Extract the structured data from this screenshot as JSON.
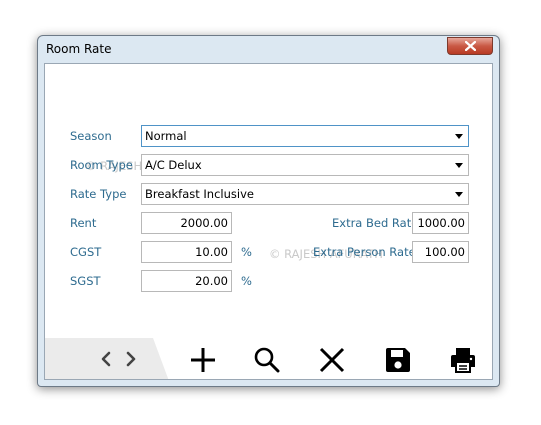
{
  "window": {
    "title": "Room Rate"
  },
  "form": {
    "season": {
      "label": "Season",
      "value": "Normal"
    },
    "room_type": {
      "label": "Room Type",
      "value": "A/C Delux"
    },
    "rate_type": {
      "label": "Rate Type",
      "value": "Breakfast Inclusive"
    },
    "rent": {
      "label": "Rent",
      "value": "2000.00"
    },
    "cgst": {
      "label": "CGST",
      "value": "10.00",
      "unit": "%"
    },
    "sgst": {
      "label": "SGST",
      "value": "20.00",
      "unit": "%"
    },
    "extra_bed_rate": {
      "label": "Extra Bed Rate",
      "value": "1000.00"
    },
    "extra_person_rate": {
      "label": "Extra Person Rate",
      "value": "100.00"
    }
  },
  "watermark": {
    "text1": "© RAJESH AFURATH",
    "text2": "© RAJESH AFURATH"
  },
  "toolbar": {
    "icons": [
      "chevron-left-icon",
      "chevron-right-icon",
      "plus-icon",
      "search-icon",
      "close-icon",
      "save-icon",
      "print-icon"
    ]
  },
  "colors": {
    "label": "#2e6b8f",
    "frame": "#dce8f2",
    "close_button": "#c95945"
  }
}
